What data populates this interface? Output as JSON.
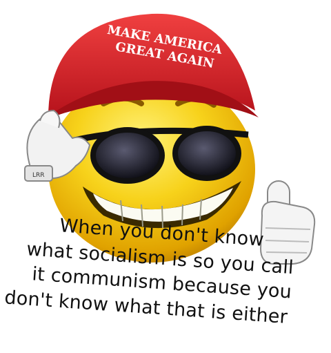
{
  "hat": {
    "line1": "MAKE AMERICA",
    "line2": "GREAT AGAIN",
    "color": "#e8262b"
  },
  "glove_tag": "LRR",
  "caption": {
    "line1": "When you don't know",
    "line2": "what socialism is so you call",
    "line3": "it communism because you",
    "line4": "don't know what that is either"
  },
  "colors": {
    "face": "#f7d21b",
    "glasses": "#111111",
    "glove": "#f2f2f2"
  }
}
